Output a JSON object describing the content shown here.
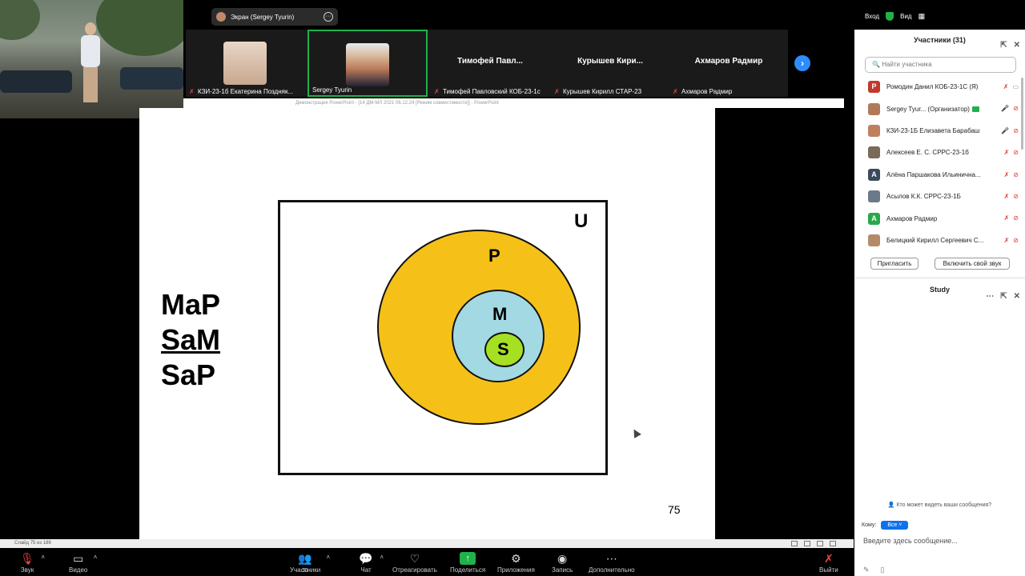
{
  "share_banner": {
    "label": "Экран (Sergey Tyurin)"
  },
  "topbar": {
    "login": "Вход",
    "view": "Вид"
  },
  "video_strip": {
    "tiles": [
      {
        "name": "КЗИ-23-1б  Екатерина Поздняк..."
      },
      {
        "name": "Sergey Tyurin"
      },
      {
        "big": "Тимофей  Павл...",
        "name": "Тимофей Павловский КОБ-23-1с"
      },
      {
        "big": "Курышев  Кири...",
        "name": "Курышев Кирилл СТАР-23"
      },
      {
        "big": "Ахмаров Радмир",
        "name": "Ахмаров Радмир"
      }
    ]
  },
  "ppt": {
    "title": "Демонстрация PowerPoint - [14 ДМ-МЛ 2021 06.12.24 [Режим совместимости]] - PowerPoint"
  },
  "slide": {
    "lines": [
      "MaP",
      "SaM",
      "SaP"
    ],
    "u": "U",
    "p": "P",
    "m": "M",
    "s": "S",
    "page": "75",
    "colors": {
      "P": "#f5c119",
      "M": "#a2d9e3",
      "S": "#a5e022"
    }
  },
  "statusbar": {
    "slide": "Слайд 75 из 186"
  },
  "toolbar": {
    "sound": "Звук",
    "video": "Видео",
    "participants": "Участники",
    "participants_count": "31",
    "chat": "Чат",
    "react": "Отреагировать",
    "share": "Поделиться",
    "apps": "Приложения",
    "record": "Запись",
    "more": "Дополнительно",
    "leave": "Выйти"
  },
  "panel": {
    "title": "Участники (31)",
    "search_placeholder": "Найти участника",
    "participants": [
      {
        "name": "Ромодин Данил КОБ-23-1С (Я)",
        "initial": "Р",
        "color": "#c0392b"
      },
      {
        "name": "Sergey Tyur... (Организатор)",
        "initial": "",
        "color": "#b07a5a"
      },
      {
        "name": "КЗИ-23-1Б Елизавета Барабаш",
        "initial": "",
        "color": "#c08060"
      },
      {
        "name": "Алексеев Е. С. СРРС-23-1б",
        "initial": "",
        "color": "#7a6a5a"
      },
      {
        "name": "Алёна Паршакова Ильинична...",
        "initial": "А",
        "color": "#3a4a5c"
      },
      {
        "name": "Асылов К.К. СРРС-23-1Б",
        "initial": "",
        "color": "#6a7a8a"
      },
      {
        "name": "Ахмаров Радмир",
        "initial": "А",
        "color": "#2aa84a"
      },
      {
        "name": "Белицкий Кирилл Сергеевич С...",
        "initial": "",
        "color": "#b58a6a"
      }
    ],
    "invite": "Пригласить",
    "unmute": "Включить свой звук",
    "chat_title": "Study",
    "who_can_see": "Кто может видеть ваши сообщения?",
    "to_label": "Кому:",
    "to_value": "Все",
    "input_placeholder": "Введите здесь сообщение..."
  }
}
